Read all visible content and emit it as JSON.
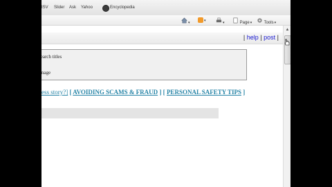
{
  "links_bar": {
    "items": [
      {
        "label": "ISV"
      },
      {
        "label": "Slider"
      },
      {
        "label": "Ask"
      },
      {
        "label": "Yahoo"
      },
      {
        "label": "Encyclopedia"
      }
    ]
  },
  "command_bar": {
    "page_label": "Page",
    "tools_label": "Tools"
  },
  "header": {
    "open": "|",
    "help": "help",
    "sep": "|",
    "post": "post",
    "close": "|"
  },
  "search_box": {
    "option_titles": "search titles",
    "option_image": "image"
  },
  "nav": {
    "first": "ess story?]",
    "sep1": " [ ",
    "avoiding": "AVOIDING SCAMS & FRAUD",
    "sep2": " ] [ ",
    "safety": "PERSONAL SAFETY TIPS",
    "sep3": " ]"
  },
  "colors": {
    "link_teal": "#2a86a8",
    "link_blue": "#1a1ad0",
    "background": "#000000"
  }
}
